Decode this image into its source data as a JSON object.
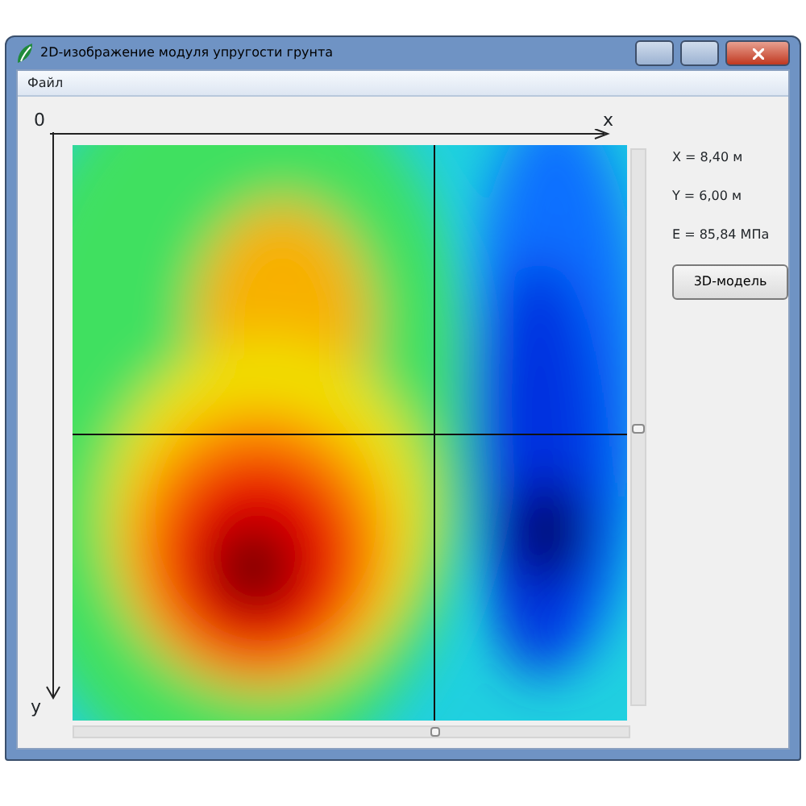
{
  "window": {
    "title": "2D-изображение модуля упругости грунта"
  },
  "menu": [
    "Файл"
  ],
  "axes": {
    "origin": "0",
    "x": "x",
    "y": "y"
  },
  "readouts": [
    "X = 8,40 м",
    "Y = 6,00 м",
    "E = 85,84 МПа"
  ],
  "button": "3D-модель",
  "sliders": {
    "horizontal": {
      "level": 0.65
    },
    "vertical": {
      "level": 0.5
    }
  }
}
